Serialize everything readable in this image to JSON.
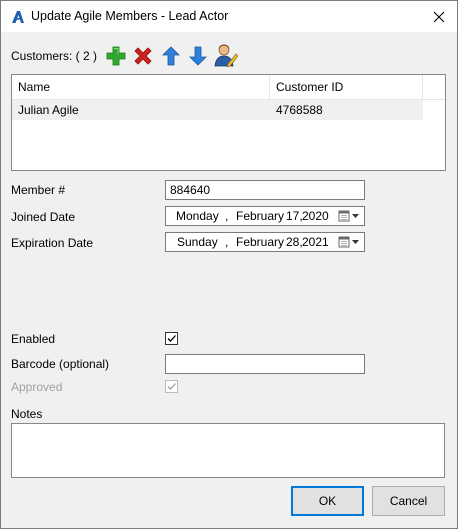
{
  "window": {
    "title": "Update Agile Members - Lead Actor"
  },
  "customers": {
    "label": "Customers: ( 2 )",
    "toolbar": {
      "add_icon": "plus-icon",
      "delete_icon": "x-icon",
      "up_icon": "arrow-up-icon",
      "down_icon": "arrow-down-icon",
      "edit_icon": "user-edit-icon"
    },
    "columns": [
      "Name",
      "Customer ID"
    ],
    "rows": [
      {
        "name": "Julian Agile",
        "customer_id": "4768588"
      }
    ]
  },
  "member": {
    "label": "Member #",
    "value": "884640"
  },
  "joined_date": {
    "label": "Joined Date",
    "weekday": "Monday",
    "sep": ",",
    "month": "February",
    "day": "17,",
    "year": "2020"
  },
  "expiration_date": {
    "label": "Expiration Date",
    "weekday": "Sunday",
    "sep": ",",
    "month": "February",
    "day": "28,",
    "year": "2021"
  },
  "enabled": {
    "label": "Enabled",
    "checked": true
  },
  "barcode": {
    "label": "Barcode (optional)",
    "value": ""
  },
  "approved": {
    "label": "Approved",
    "checked": true,
    "disabled": true
  },
  "notes": {
    "label": "Notes",
    "value": ""
  },
  "buttons": {
    "ok": "OK",
    "cancel": "Cancel"
  },
  "colors": {
    "accent": "#0078d7",
    "brand": "#1f5fb3",
    "add": "#2ea82e",
    "delete": "#d32020"
  }
}
